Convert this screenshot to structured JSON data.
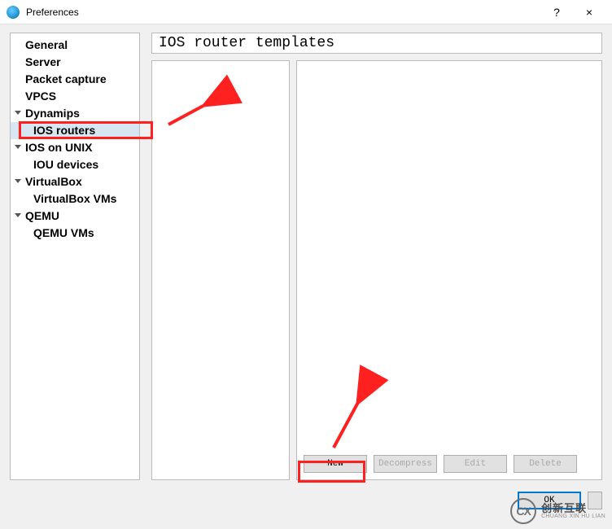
{
  "window": {
    "title": "Preferences",
    "help_hint": "?",
    "close_hint": "×"
  },
  "sidebar": {
    "items": [
      {
        "label": "General",
        "expandable": false,
        "child": false,
        "selected": false
      },
      {
        "label": "Server",
        "expandable": false,
        "child": false,
        "selected": false
      },
      {
        "label": "Packet capture",
        "expandable": false,
        "child": false,
        "selected": false
      },
      {
        "label": "VPCS",
        "expandable": false,
        "child": false,
        "selected": false
      },
      {
        "label": "Dynamips",
        "expandable": true,
        "child": false,
        "selected": false
      },
      {
        "label": "IOS routers",
        "expandable": false,
        "child": true,
        "selected": true
      },
      {
        "label": "IOS on UNIX",
        "expandable": true,
        "child": false,
        "selected": false
      },
      {
        "label": "IOU devices",
        "expandable": false,
        "child": true,
        "selected": false
      },
      {
        "label": "VirtualBox",
        "expandable": true,
        "child": false,
        "selected": false
      },
      {
        "label": "VirtualBox VMs",
        "expandable": false,
        "child": true,
        "selected": false
      },
      {
        "label": "QEMU",
        "expandable": true,
        "child": false,
        "selected": false
      },
      {
        "label": "QEMU VMs",
        "expandable": false,
        "child": true,
        "selected": false
      }
    ]
  },
  "main": {
    "title": "IOS router templates",
    "buttons": {
      "new": "New",
      "decompress": "Decompress",
      "edit": "Edit",
      "delete": "Delete"
    }
  },
  "footer": {
    "ok": "OK"
  },
  "watermark": {
    "logo": "CX",
    "cn": "创新互联",
    "en": "CHUANG XIN HU LIAN"
  }
}
